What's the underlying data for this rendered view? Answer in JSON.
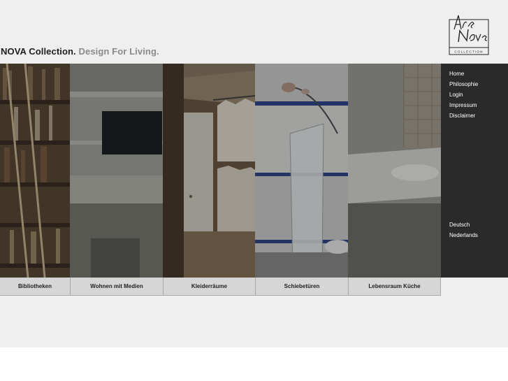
{
  "header": {
    "brand": "NOVA Collection.",
    "motto": "Design For Living.",
    "logo": {
      "line1": "Ars",
      "line2": "Nova",
      "caption": "COLLECTION"
    }
  },
  "nav": {
    "items": [
      {
        "label": "Home"
      },
      {
        "label": "Philosophie"
      },
      {
        "label": "Login"
      },
      {
        "label": "Impressum"
      },
      {
        "label": "Disclaimer"
      }
    ],
    "languages": [
      {
        "label": "Deutsch"
      },
      {
        "label": "Nederlands"
      }
    ]
  },
  "categories": [
    {
      "label": "Bibliotheken",
      "image": "bookshelf-with-ladder"
    },
    {
      "label": "Wohnen mit Medien",
      "image": "living-room-with-tv"
    },
    {
      "label": "Kleiderräume",
      "image": "walk-in-closet"
    },
    {
      "label": "Schiebetüren",
      "image": "glass-vase-sliding-door"
    },
    {
      "label": "Lebensraum Küche",
      "image": "kitchen-counter"
    }
  ],
  "colors": {
    "background": "#efefef",
    "menu_background": "#2a2a2a",
    "tab_background": "#d6d6d6",
    "brand_text": "#1e1e1e",
    "motto_text": "#8a8a8a"
  }
}
